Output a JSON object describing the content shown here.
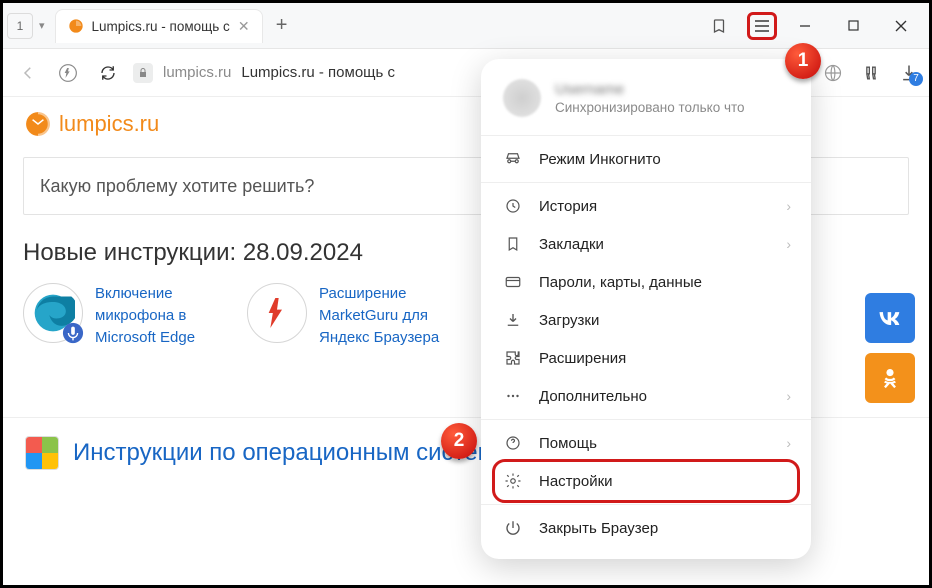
{
  "window": {
    "tab_count": "1",
    "tab_title": "Lumpics.ru - помощь с",
    "url_host": "lumpics.ru",
    "url_title": "Lumpics.ru - помощь с",
    "downloads_badge": "7"
  },
  "page": {
    "brand_name": "lumpics.ru",
    "search_placeholder": "Какую проблему хотите решить?",
    "new_section": "Новые инструкции: 28.09.2024",
    "card1": "Включение микрофона в Microsoft Edge",
    "card2": "Расширение MarketGuru для Яндекс Браузера",
    "bottom_heading": "Инструкции по операционным системам"
  },
  "menu": {
    "user": "Username",
    "sync": "Синхронизировано только что",
    "incognito": "Режим Инкогнито",
    "history": "История",
    "bookmarks": "Закладки",
    "passwords": "Пароли, карты, данные",
    "downloads": "Загрузки",
    "extensions": "Расширения",
    "more": "Дополнительно",
    "help": "Помощь",
    "settings": "Настройки",
    "close": "Закрыть Браузер"
  },
  "callout": {
    "one": "1",
    "two": "2"
  },
  "colors": {
    "vk": "#2f7de1",
    "ok": "#f3911b",
    "accent": "#f28a1a",
    "link": "#1866c4",
    "highlight": "#d11a1a"
  }
}
